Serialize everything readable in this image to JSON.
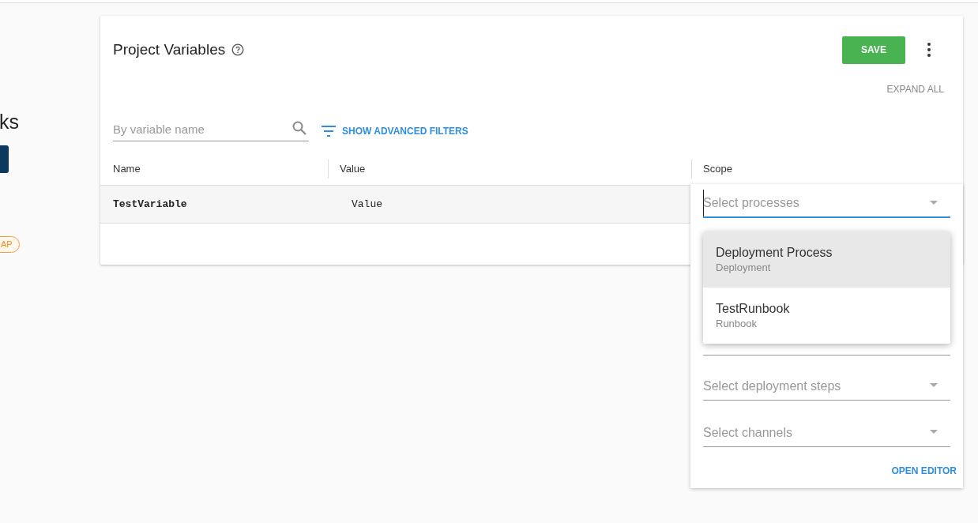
{
  "sidebar": {
    "heading": "ks",
    "badge": "AP"
  },
  "card": {
    "title": "Project Variables",
    "save": "SAVE",
    "expand": "EXPAND ALL",
    "search": {
      "placeholder": "By variable name"
    },
    "filters": "SHOW ADVANCED FILTERS",
    "columns": [
      "Name",
      "Value",
      "Scope"
    ],
    "rows": [
      {
        "name": "TestVariable",
        "value": "Value"
      }
    ]
  },
  "scope": {
    "fields": [
      {
        "placeholder": "Select processes",
        "focused": true
      },
      {
        "placeholder": "Select deployment steps",
        "focused": false
      },
      {
        "placeholder": "Select channels",
        "focused": false
      }
    ],
    "menu": [
      {
        "label": "Deployment Process",
        "sublabel": "Deployment",
        "selected": true
      },
      {
        "label": "TestRunbook",
        "sublabel": "Runbook",
        "selected": false
      }
    ],
    "open_editor": "OPEN EDITOR"
  }
}
